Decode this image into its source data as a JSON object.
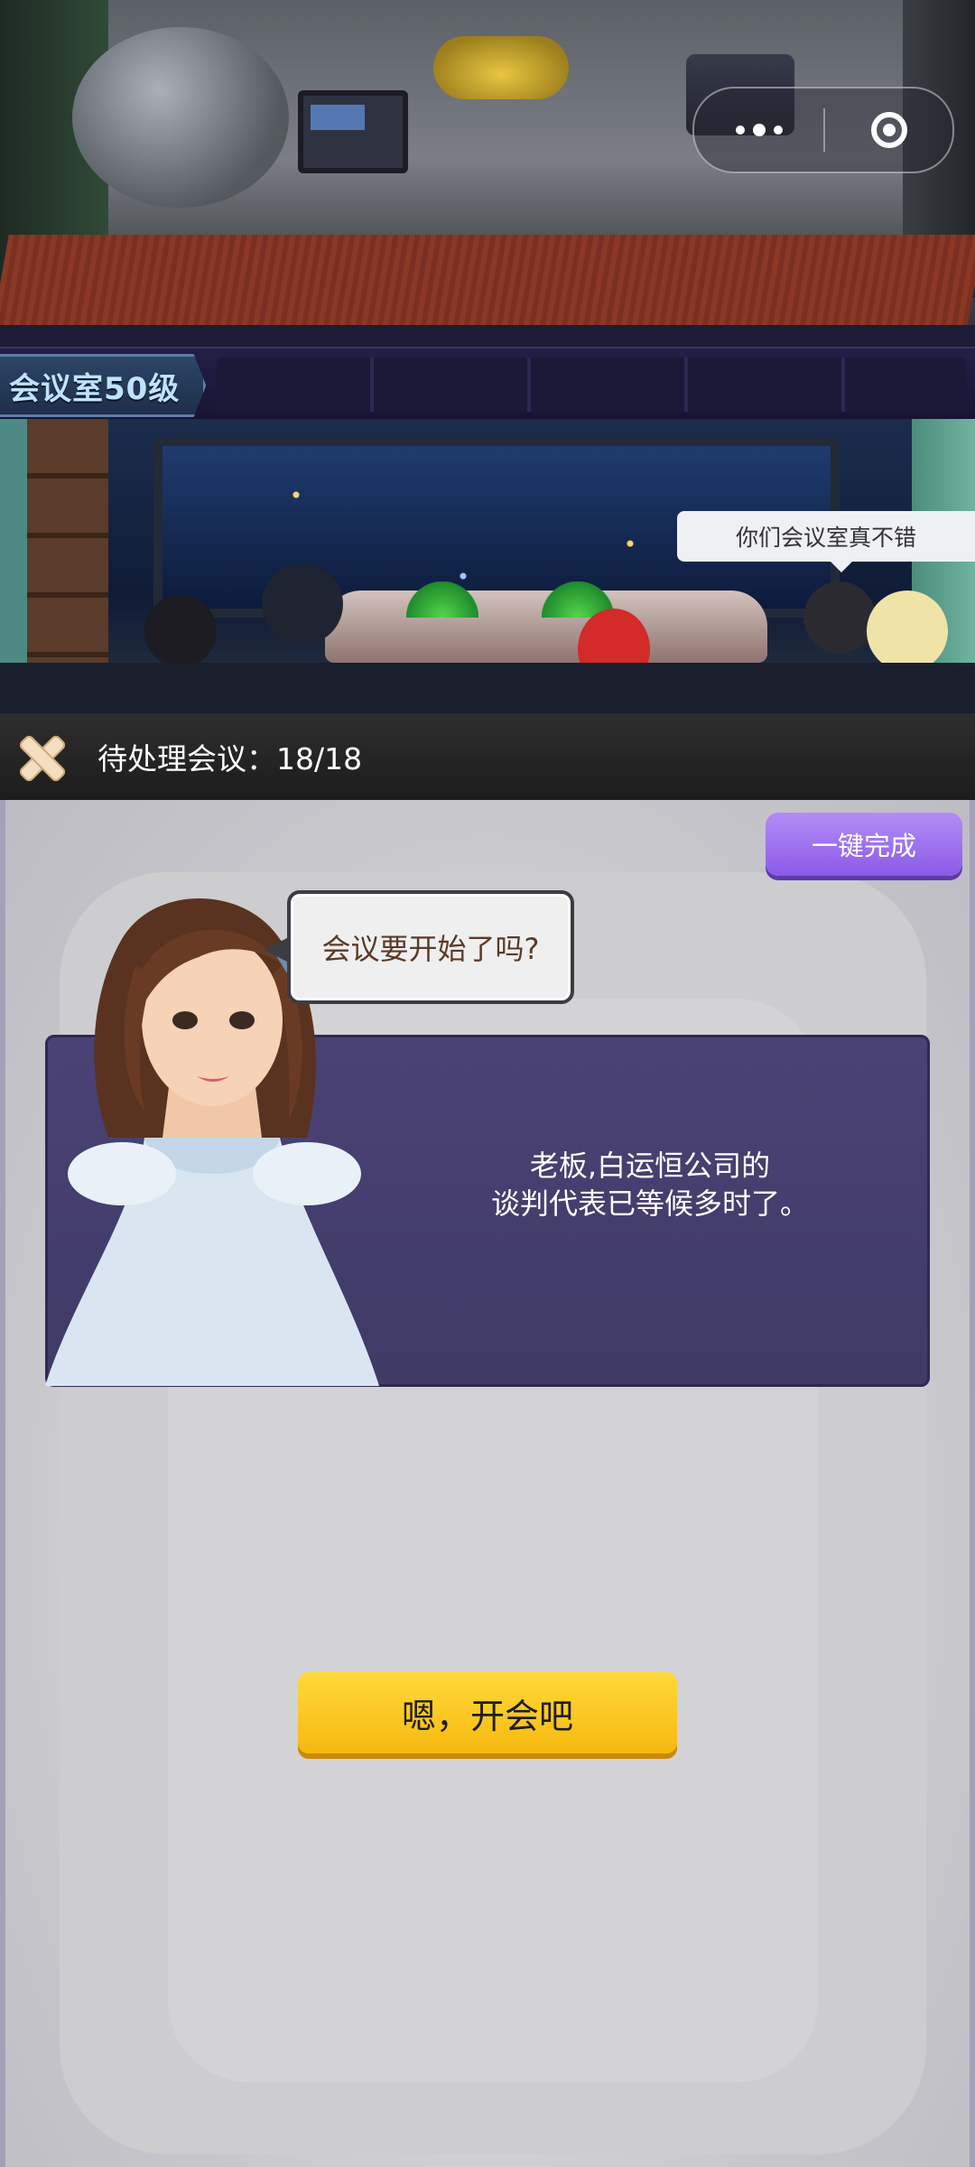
{
  "capsule": {
    "more_icon": "more-dots-icon",
    "close_icon": "mini-program-close-icon"
  },
  "level_tag": "会议室50级",
  "scene_speech": "你们会议室真不错",
  "header": {
    "title": "待处理会议：18/18",
    "close_icon": "close-x-icon"
  },
  "one_key_button": "一键完成",
  "bubble_text": "会议要开始了吗?",
  "dialog": {
    "line1": "老板,白运恒公司的",
    "line2": "谈判代表已等候多时了。"
  },
  "start_button": "嗯，开会吧",
  "colors": {
    "start_button": "#f6b90f",
    "one_key_button": "#8b5ae8",
    "dialog_panel": "#4a4275",
    "header_bar": "#2e2e2e"
  }
}
